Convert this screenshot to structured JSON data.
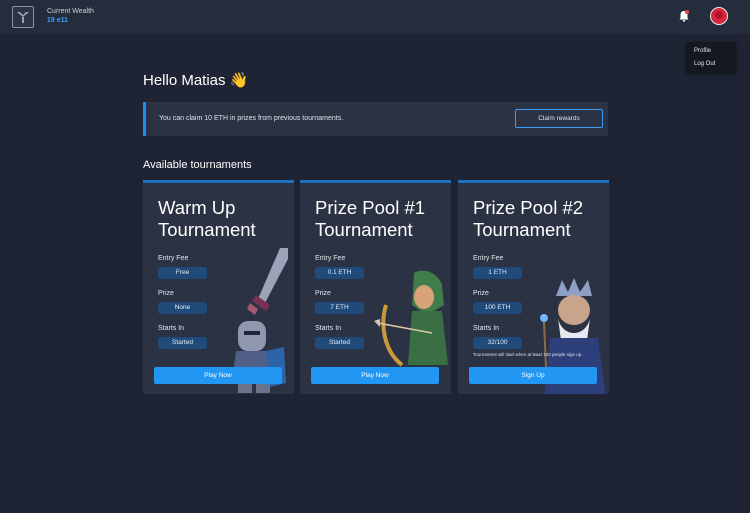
{
  "header": {
    "wealth_label": "Current Wealth",
    "wealth_value": "19 e11"
  },
  "user_menu": {
    "items": [
      "Profile",
      "Log Out"
    ]
  },
  "main": {
    "greeting": "Hello Matias 👋",
    "claim": {
      "message": "You can claim 10 ETH in prizes from previous tournaments.",
      "button": "Claim rewards"
    },
    "section_title": "Available tournaments"
  },
  "tournaments": [
    {
      "title_line1": "Warm Up",
      "title_line2": "Tournament",
      "entry_fee_label": "Entry Fee",
      "entry_fee": "Free",
      "prize_label": "Prize",
      "prize": "None",
      "starts_label": "Starts In",
      "starts": "Started",
      "note": "",
      "button": "Play Now"
    },
    {
      "title_line1": "Prize Pool #1",
      "title_line2": "Tournament",
      "entry_fee_label": "Entry Fee",
      "entry_fee": "0.1 ETH",
      "prize_label": "Prize",
      "prize": "7 ETH",
      "starts_label": "Starts In",
      "starts": "Started",
      "note": "",
      "button": "Play Now"
    },
    {
      "title_line1": "Prize Pool #2",
      "title_line2": "Tournament",
      "entry_fee_label": "Entry Fee",
      "entry_fee": "1 ETH",
      "prize_label": "Prize",
      "prize": "100 ETH",
      "starts_label": "Starts In",
      "starts": "32/100",
      "note": "Tournament will start when at least 100 people sign up.",
      "button": "Sign Up"
    }
  ],
  "colors": {
    "background": "#1e2433",
    "panel": "#2b3243",
    "accent": "#2196f3",
    "pill": "#1f4a7a"
  }
}
